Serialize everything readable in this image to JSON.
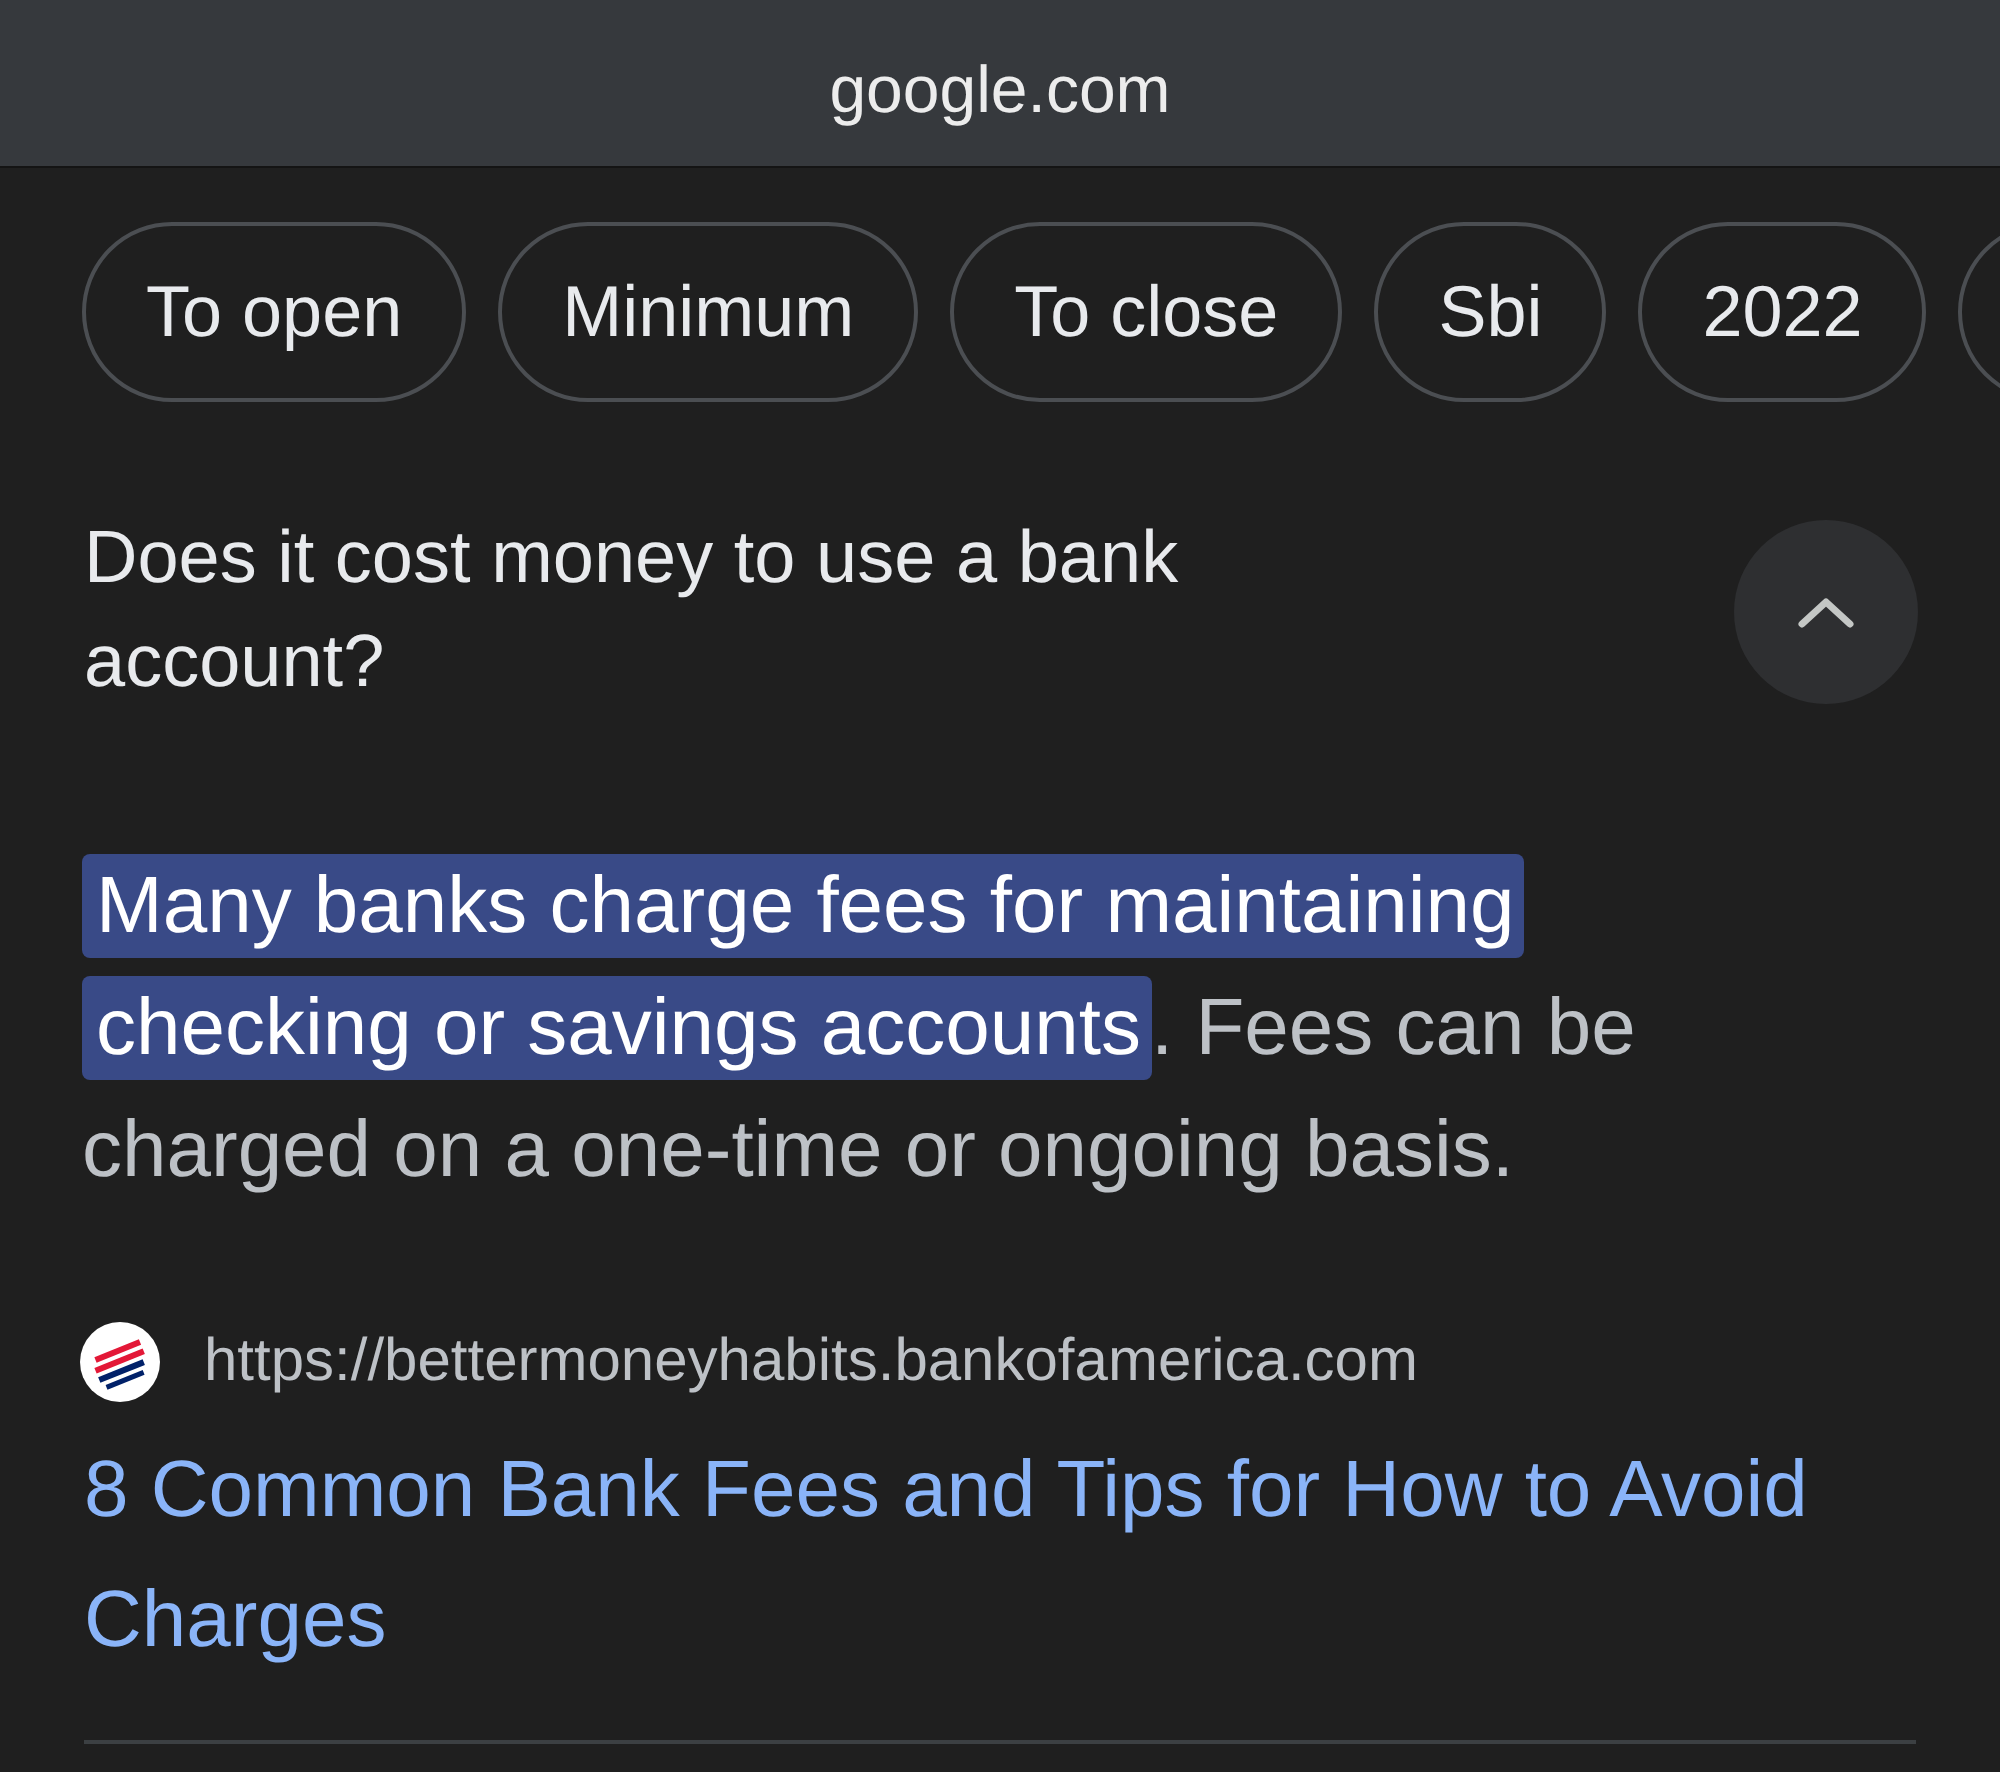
{
  "address_bar": {
    "domain": "google.com"
  },
  "chips": [
    {
      "label": "To open"
    },
    {
      "label": "Minimum"
    },
    {
      "label": "To close"
    },
    {
      "label": "Sbi"
    },
    {
      "label": "2022"
    }
  ],
  "faq": {
    "question": "Does it cost money to use a bank account?",
    "expanded": true,
    "answer": {
      "highlight": "Many banks charge fees for maintaining checking or savings accounts",
      "text": ". Fees can be charged on a one-time or ongoing basis."
    },
    "source": {
      "url": "https://bettermoneyhabits.bankofamerica.com",
      "title": "8 Common Bank Fees and Tips for How to Avoid Charges"
    }
  }
}
